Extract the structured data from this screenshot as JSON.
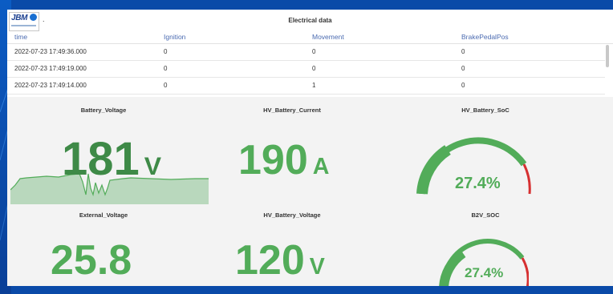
{
  "table": {
    "title": "Electrical data",
    "columns": [
      "time",
      "Ignition",
      "Movement",
      "BrakePedalPos"
    ],
    "rows": [
      [
        "2022-07-23 17:49:36.000",
        "0",
        "0",
        "0"
      ],
      [
        "2022-07-23 17:49:19.000",
        "0",
        "0",
        "0"
      ],
      [
        "2022-07-23 17:49:14.000",
        "0",
        "1",
        "0"
      ]
    ]
  },
  "logo": {
    "text": "JBM"
  },
  "panels": {
    "battery_voltage": {
      "title": "Battery_Voltage",
      "value": "181",
      "unit": "V"
    },
    "hv_battery_current": {
      "title": "HV_Battery_Current",
      "value": "190",
      "unit": "A"
    },
    "hv_battery_soc": {
      "title": "HV_Battery_SoC",
      "value": "27.4%",
      "percent": 27.4
    },
    "external_voltage": {
      "title": "External_Voltage",
      "value": "25.8"
    },
    "hv_battery_voltage": {
      "title": "HV_Battery_Voltage",
      "value": "120",
      "unit": "V"
    },
    "b2v_soc": {
      "title": "B2V_SOC",
      "value": "27.4%",
      "percent": 27.4
    }
  },
  "colors": {
    "accent_green": "#52ac59",
    "gauge_red": "#d63031",
    "header_text": "#4b6bb1",
    "background": "#0a4aa8"
  }
}
